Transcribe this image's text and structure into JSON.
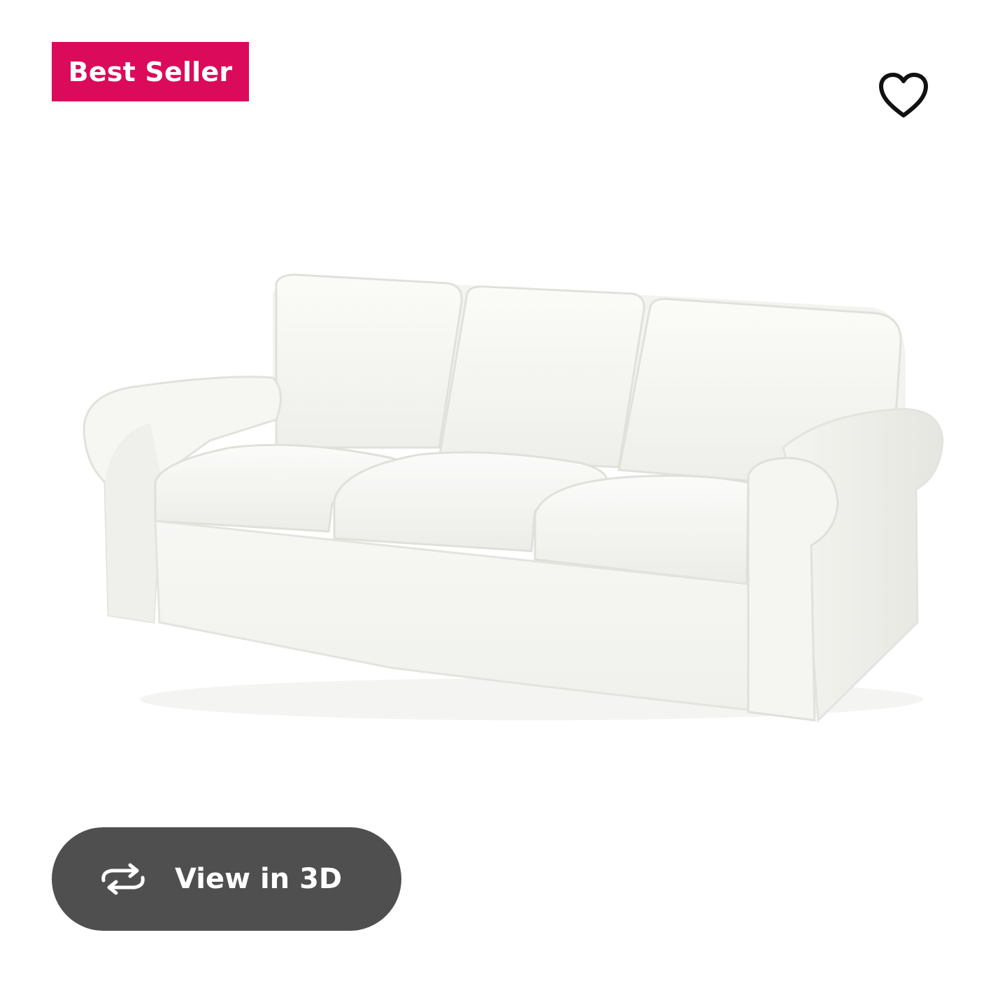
{
  "badge": {
    "label": "Best Seller",
    "background": "#DC0A5A",
    "text_color": "#FFFFFF"
  },
  "favorite": {
    "icon": "heart-icon",
    "color": "#111111"
  },
  "product_image": {
    "subject": "sofa"
  },
  "view_3d": {
    "label": "View in 3D",
    "icon": "rotate-arrows-icon",
    "background": "#4F4F4F",
    "text_color": "#FFFFFF"
  }
}
